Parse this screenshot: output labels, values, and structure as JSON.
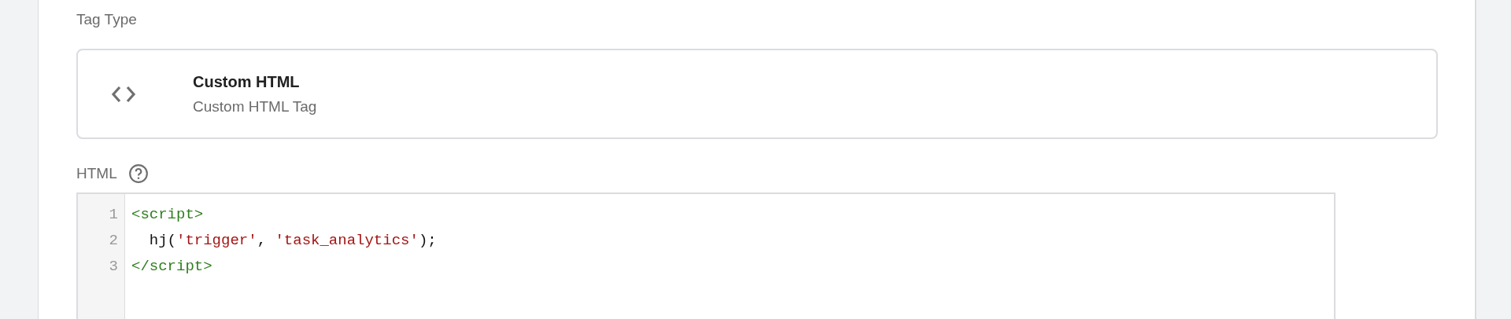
{
  "tag_type": {
    "label": "Tag Type",
    "card": {
      "title": "Custom HTML",
      "subtitle": "Custom HTML Tag"
    }
  },
  "html": {
    "label": "HTML",
    "lines": [
      {
        "number": "1",
        "tokens": [
          {
            "kind": "tag",
            "text": "<script>"
          }
        ]
      },
      {
        "number": "2",
        "tokens": [
          {
            "kind": "plain",
            "text": "  hj("
          },
          {
            "kind": "string",
            "text": "'trigger'"
          },
          {
            "kind": "plain",
            "text": ", "
          },
          {
            "kind": "string",
            "text": "'task_analytics'"
          },
          {
            "kind": "plain",
            "text": ");"
          }
        ]
      },
      {
        "number": "3",
        "tokens": [
          {
            "kind": "tag",
            "text": "</script>"
          }
        ]
      }
    ]
  }
}
